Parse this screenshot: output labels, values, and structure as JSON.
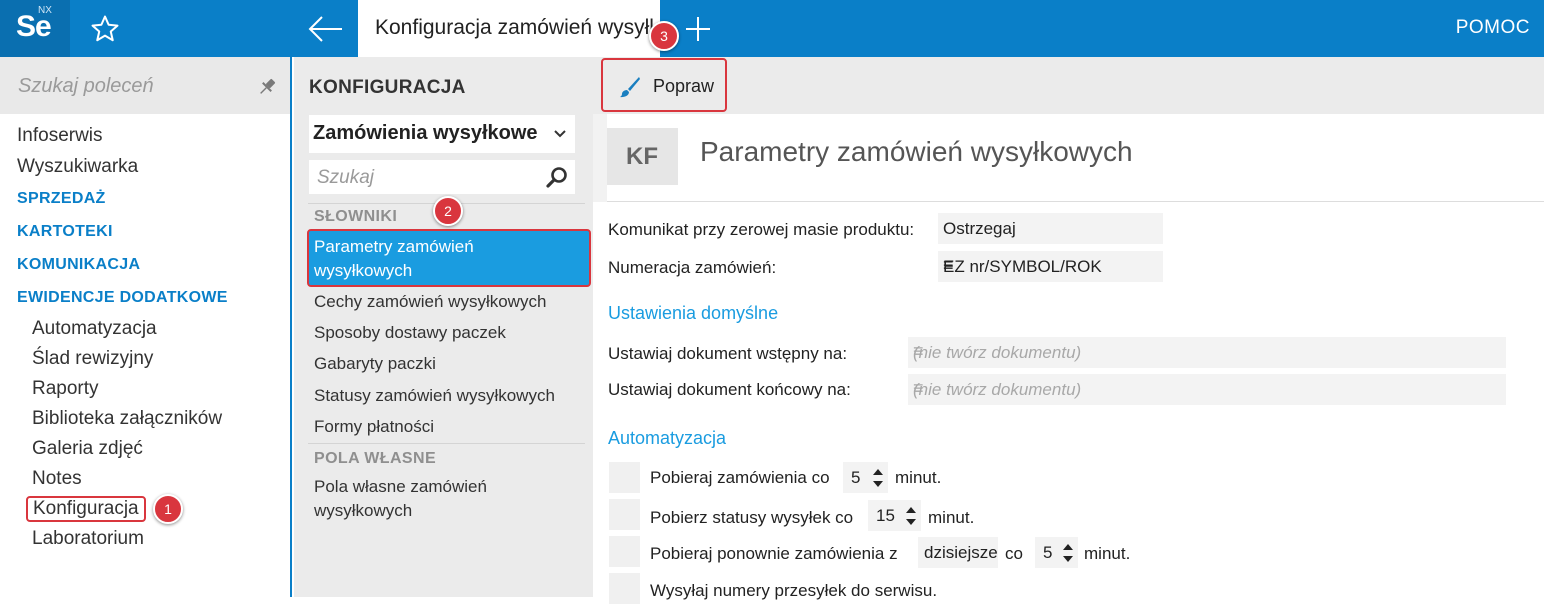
{
  "topbar": {
    "logo_text": "Se",
    "logo_sup": "NX",
    "tab_title": "Konfiguracja zamówień wysyłkowych",
    "help_label": "POMOC",
    "colors": {
      "accent": "#0a7fc8",
      "highlight": "#1a9ce0",
      "marker": "#d9363e"
    }
  },
  "left": {
    "search_placeholder": "Szukaj poleceń",
    "items": [
      {
        "label": "Infoserwis"
      },
      {
        "label": "Wyszukiwarka"
      }
    ],
    "sections": [
      {
        "label": "SPRZEDAŻ"
      },
      {
        "label": "KARTOTEKI"
      },
      {
        "label": "KOMUNIKACJA"
      },
      {
        "label": "EWIDENCJE DODATKOWE"
      }
    ],
    "subitems": [
      {
        "label": "Automatyzacja"
      },
      {
        "label": "Ślad rewizyjny"
      },
      {
        "label": "Raporty"
      },
      {
        "label": "Biblioteka załączników"
      },
      {
        "label": "Galeria zdjęć"
      },
      {
        "label": "Notes"
      },
      {
        "label": "Konfiguracja"
      },
      {
        "label": "Laboratorium"
      }
    ]
  },
  "middle": {
    "title": "KONFIGURACJA",
    "selected_module": "Zamówienia wysyłkowe",
    "search_placeholder": "Szukaj",
    "section_slowniki": "SŁOWNIKI",
    "active_item": "Parametry zamówień wysyłkowych",
    "items": [
      {
        "label": "Cechy zamówień wysyłkowych"
      },
      {
        "label": "Sposoby dostawy paczek"
      },
      {
        "label": "Gabaryty paczki"
      },
      {
        "label": "Statusy zamówień wysyłkowych"
      },
      {
        "label": "Formy płatności"
      }
    ],
    "section_pola": "POLA WŁASNE",
    "pola_item": "Pola własne zamówień wysyłkowych"
  },
  "main": {
    "popraw_label": "Popraw",
    "badge_text": "KF",
    "title": "Parametry zamówień wysyłkowych",
    "fields": {
      "komunikat_label": "Komunikat przy zerowej masie produktu:",
      "komunikat_value": "Ostrzegaj",
      "numeracja_label": "Numeracja zamówień:",
      "numeracja_value": "EZ nr/SYMBOL/ROK"
    },
    "ustawienia": {
      "heading": "Ustawienia domyślne",
      "wstepny_label": "Ustawiaj dokument wstępny na:",
      "wstepny_value": "(nie twórz dokumentu)",
      "koncowy_label": "Ustawiaj dokument końcowy na:",
      "koncowy_value": "(nie twórz dokumentu)"
    },
    "automatyzacja": {
      "heading": "Automatyzacja",
      "row1_text": "Pobieraj zamówienia co",
      "row1_value": "5",
      "row1_unit": "minut.",
      "row2_text": "Pobierz statusy wysyłek co",
      "row2_value": "15",
      "row2_unit": "minut.",
      "row3_text": "Pobieraj ponownie zamówienia z",
      "row3_select": "dzisiejsze",
      "row3_co": "co",
      "row3_value": "5",
      "row3_unit": "minut.",
      "row4_text": "Wysyłaj numery przesyłek do serwisu."
    }
  },
  "markers": {
    "m1": "1",
    "m2": "2",
    "m3": "3"
  }
}
